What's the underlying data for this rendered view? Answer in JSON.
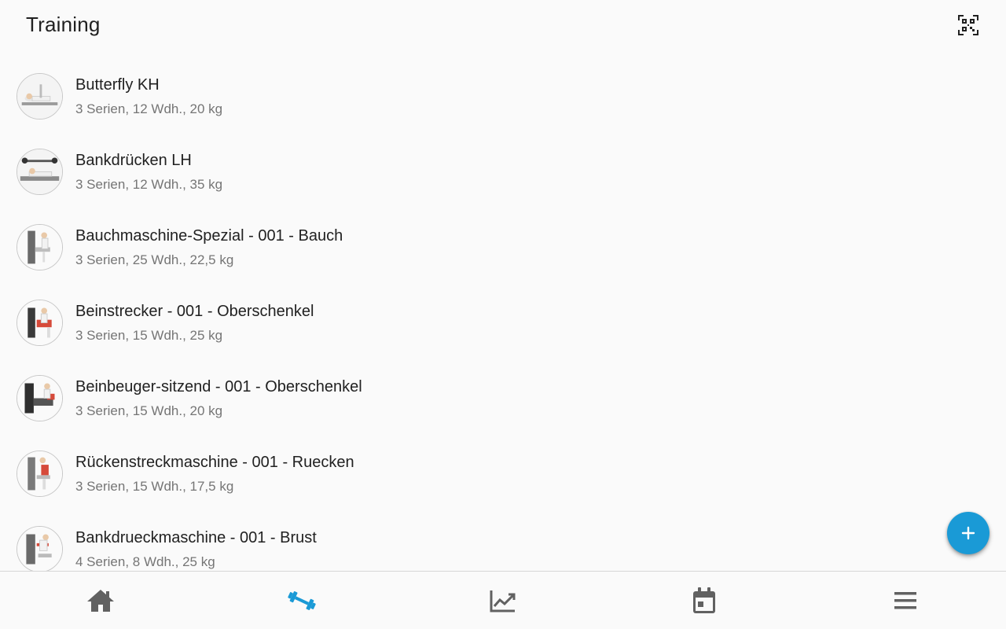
{
  "app_bar": {
    "title": "Training",
    "qr_icon": "qr-code-scanner-icon"
  },
  "exercises": [
    {
      "name": "Butterfly KH",
      "details": "3 Serien, 12 Wdh., 20 kg"
    },
    {
      "name": "Bankdrücken LH",
      "details": "3 Serien, 12 Wdh., 35 kg"
    },
    {
      "name": "Bauchmaschine-Spezial - 001 - Bauch",
      "details": "3 Serien, 25 Wdh., 22,5 kg"
    },
    {
      "name": "Beinstrecker - 001 - Oberschenkel",
      "details": "3 Serien, 15 Wdh., 25 kg"
    },
    {
      "name": "Beinbeuger-sitzend - 001 - Oberschenkel",
      "details": "3 Serien, 15 Wdh., 20 kg"
    },
    {
      "name": "Rückenstreckmaschine - 001 - Ruecken",
      "details": "3 Serien, 15 Wdh., 17,5 kg"
    },
    {
      "name": "Bankdrueckmaschine - 001 - Brust",
      "details": "4 Serien, 8 Wdh., 25 kg"
    }
  ],
  "fab": {
    "icon": "add-icon"
  },
  "bottom_nav": {
    "items": [
      {
        "icon": "home-icon",
        "active": false
      },
      {
        "icon": "dumbbell-icon",
        "active": true
      },
      {
        "icon": "trending-chart-icon",
        "active": false
      },
      {
        "icon": "calendar-icon",
        "active": false
      },
      {
        "icon": "menu-icon",
        "active": false
      }
    ]
  },
  "colors": {
    "accent": "#1a9ad6",
    "icon_inactive": "#616161",
    "background": "#fafafa",
    "secondary_text": "#757575"
  }
}
